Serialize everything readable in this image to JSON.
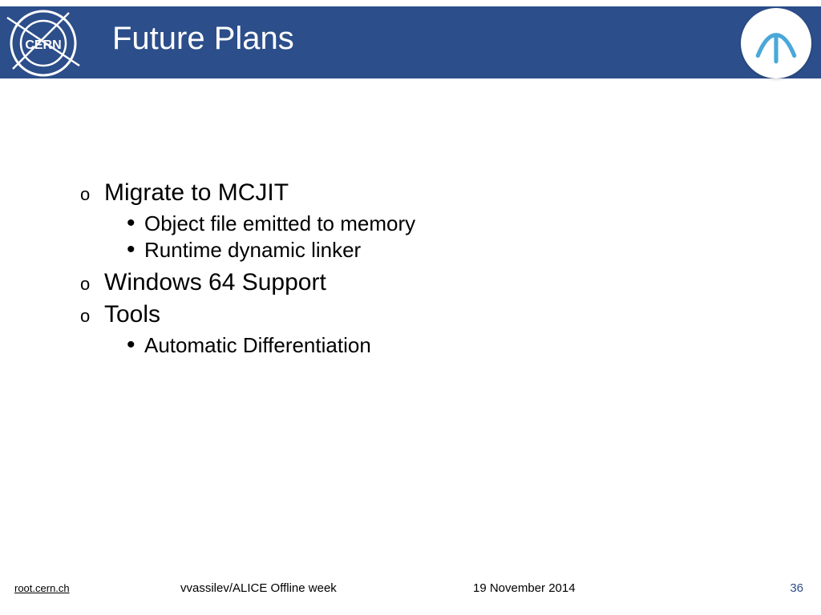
{
  "header": {
    "title": "Future Plans"
  },
  "content": {
    "items": [
      {
        "marker": "o",
        "text": "Migrate to MCJIT",
        "level": 1
      },
      {
        "marker": "•",
        "text": "Object file emitted to memory",
        "level": 2
      },
      {
        "marker": "•",
        "text": "Runtime dynamic linker",
        "level": 2
      },
      {
        "marker": "o",
        "text": "Windows 64 Support",
        "level": 1
      },
      {
        "marker": "o",
        "text": "Tools",
        "level": 1
      },
      {
        "marker": "•",
        "text": "Automatic Differentiation",
        "level": 2
      }
    ]
  },
  "footer": {
    "link": "root.cern.ch",
    "center": "vvassilev/ALICE Offline week",
    "date": "19 November 2014",
    "page": "36"
  }
}
